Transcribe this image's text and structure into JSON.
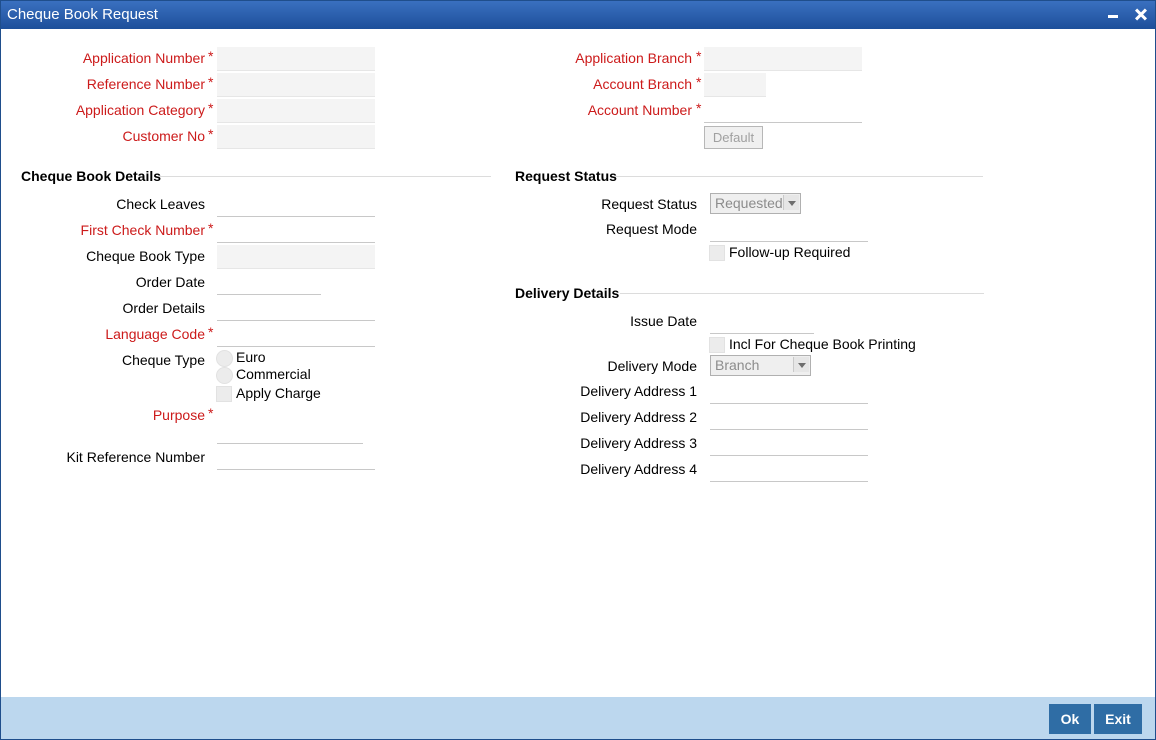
{
  "window": {
    "title": "Cheque Book Request"
  },
  "header": {
    "application_number": "Application Number",
    "reference_number": "Reference Number",
    "application_category": "Application Category",
    "customer_no": "Customer No",
    "application_branch": "Application Branch",
    "account_branch": "Account Branch",
    "account_number": "Account Number",
    "default_button": "Default",
    "required_marker": "*"
  },
  "cheque_book_details": {
    "section_title": "Cheque Book Details",
    "check_leaves": "Check Leaves",
    "first_check_number": "First Check Number",
    "cheque_book_type": "Cheque Book Type",
    "order_date": "Order Date",
    "order_details": "Order Details",
    "language_code": "Language Code",
    "cheque_type": "Cheque Type",
    "cheque_type_options": [
      "Euro",
      "Commercial"
    ],
    "apply_charge": "Apply Charge",
    "purpose": "Purpose",
    "kit_reference_number": "Kit Reference Number"
  },
  "request_status": {
    "section_title": "Request Status",
    "request_status_label": "Request Status",
    "request_status_value": "Requested",
    "request_mode": "Request Mode",
    "follow_up_required": "Follow-up Required"
  },
  "delivery_details": {
    "section_title": "Delivery Details",
    "issue_date": "Issue Date",
    "incl_for_printing": "Incl For Cheque Book Printing",
    "delivery_mode_label": "Delivery Mode",
    "delivery_mode_value": "Branch",
    "delivery_address_1": "Delivery Address 1",
    "delivery_address_2": "Delivery Address 2",
    "delivery_address_3": "Delivery Address 3",
    "delivery_address_4": "Delivery Address 4"
  },
  "footer": {
    "ok": "Ok",
    "exit": "Exit"
  },
  "colors": {
    "title_bar": "#1d4f9a",
    "required": "#cc1a1a",
    "footer": "#bcd7ee",
    "footer_button": "#2f6da5"
  }
}
